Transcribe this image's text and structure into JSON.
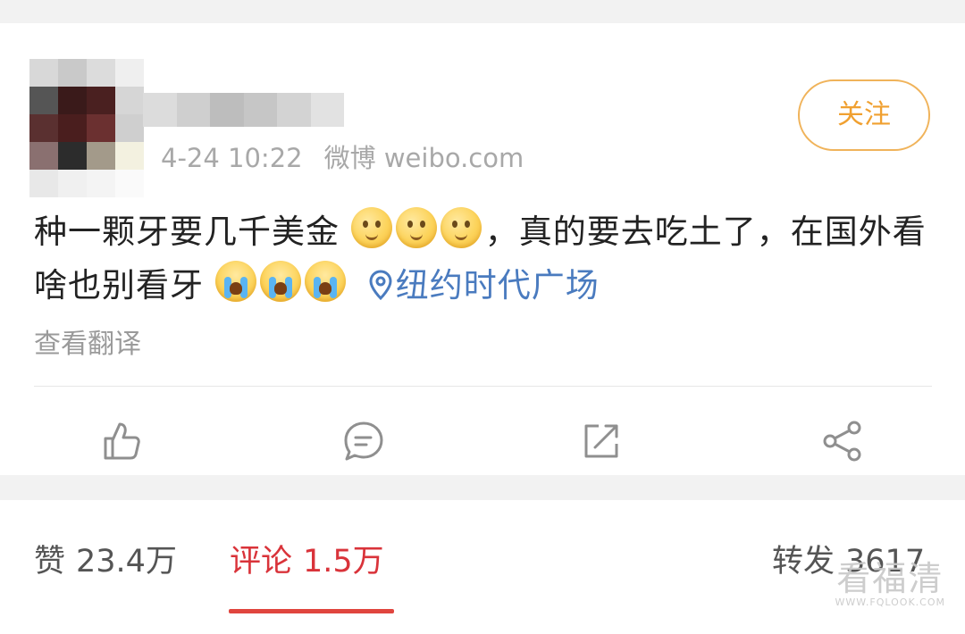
{
  "post": {
    "timestamp": "4-24 10:22",
    "source": "微博 weibo.com",
    "follow_label": "关注",
    "text_part1": "种一颗牙要几千美金",
    "text_part2": "，真的要去吃土了，在国外看啥也别看牙",
    "location": "纽约时代广场",
    "translate_label": "查看翻译"
  },
  "actions": [
    {
      "icon": "thumbs-up-icon"
    },
    {
      "icon": "comment-icon"
    },
    {
      "icon": "repost-icon"
    },
    {
      "icon": "share-icon"
    }
  ],
  "stats": {
    "likes_label": "赞",
    "likes_value": "23.4万",
    "comments_label": "评论",
    "comments_value": "1.5万",
    "reposts_label": "转发",
    "reposts_value": "3617"
  },
  "watermark": {
    "main": "看福清",
    "sub": "WWW.FQLOOK.COM"
  },
  "colors": {
    "accent_orange": "#f0a030",
    "active_red": "#d9333a",
    "location_blue": "#4a7bbf"
  }
}
